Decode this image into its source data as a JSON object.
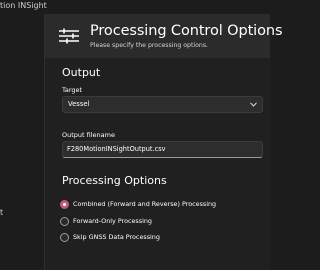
{
  "window": {
    "title": "tion INSight"
  },
  "left_pane": {
    "label": "t"
  },
  "header": {
    "title": "Processing Control Options",
    "subtitle": "Please specify the processing options.",
    "icon": "sliders-icon"
  },
  "output": {
    "section_title": "Output",
    "target_label": "Target",
    "target_value": "Vessel",
    "filename_label": "Output filename",
    "filename_value": "F280MotionINSightOutput.csv"
  },
  "processing": {
    "section_title": "Processing Options",
    "options": [
      {
        "label": "Combined (Forward and Reverse) Processing",
        "selected": true
      },
      {
        "label": "Forward-Only Processing",
        "selected": false
      },
      {
        "label": "Skip GNSS Data Processing",
        "selected": false
      }
    ]
  },
  "colors": {
    "accent": "#c05a7f",
    "background": "#202020",
    "header": "#2b2b2b"
  }
}
